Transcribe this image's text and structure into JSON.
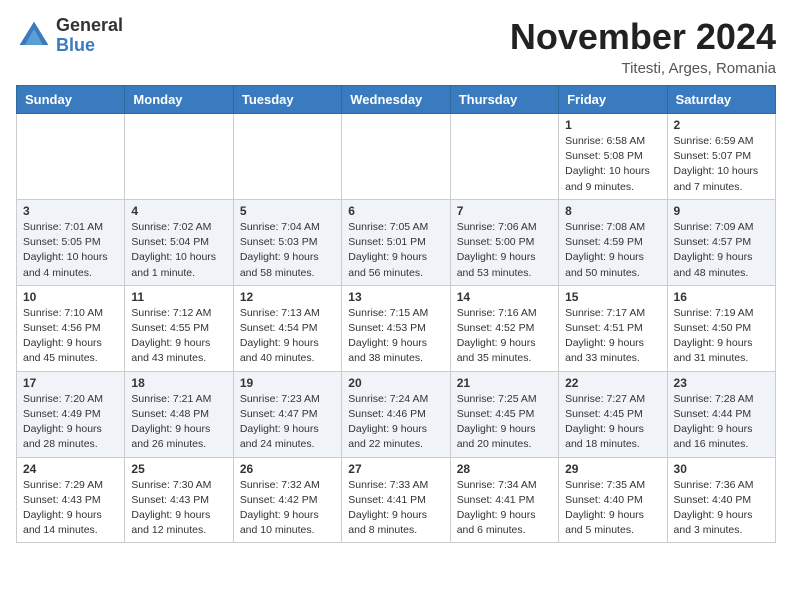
{
  "header": {
    "logo_line1": "General",
    "logo_line2": "Blue",
    "month_title": "November 2024",
    "location": "Titesti, Arges, Romania"
  },
  "weekdays": [
    "Sunday",
    "Monday",
    "Tuesday",
    "Wednesday",
    "Thursday",
    "Friday",
    "Saturday"
  ],
  "weeks": [
    [
      {
        "day": "",
        "info": ""
      },
      {
        "day": "",
        "info": ""
      },
      {
        "day": "",
        "info": ""
      },
      {
        "day": "",
        "info": ""
      },
      {
        "day": "",
        "info": ""
      },
      {
        "day": "1",
        "info": "Sunrise: 6:58 AM\nSunset: 5:08 PM\nDaylight: 10 hours and 9 minutes."
      },
      {
        "day": "2",
        "info": "Sunrise: 6:59 AM\nSunset: 5:07 PM\nDaylight: 10 hours and 7 minutes."
      }
    ],
    [
      {
        "day": "3",
        "info": "Sunrise: 7:01 AM\nSunset: 5:05 PM\nDaylight: 10 hours and 4 minutes."
      },
      {
        "day": "4",
        "info": "Sunrise: 7:02 AM\nSunset: 5:04 PM\nDaylight: 10 hours and 1 minute."
      },
      {
        "day": "5",
        "info": "Sunrise: 7:04 AM\nSunset: 5:03 PM\nDaylight: 9 hours and 58 minutes."
      },
      {
        "day": "6",
        "info": "Sunrise: 7:05 AM\nSunset: 5:01 PM\nDaylight: 9 hours and 56 minutes."
      },
      {
        "day": "7",
        "info": "Sunrise: 7:06 AM\nSunset: 5:00 PM\nDaylight: 9 hours and 53 minutes."
      },
      {
        "day": "8",
        "info": "Sunrise: 7:08 AM\nSunset: 4:59 PM\nDaylight: 9 hours and 50 minutes."
      },
      {
        "day": "9",
        "info": "Sunrise: 7:09 AM\nSunset: 4:57 PM\nDaylight: 9 hours and 48 minutes."
      }
    ],
    [
      {
        "day": "10",
        "info": "Sunrise: 7:10 AM\nSunset: 4:56 PM\nDaylight: 9 hours and 45 minutes."
      },
      {
        "day": "11",
        "info": "Sunrise: 7:12 AM\nSunset: 4:55 PM\nDaylight: 9 hours and 43 minutes."
      },
      {
        "day": "12",
        "info": "Sunrise: 7:13 AM\nSunset: 4:54 PM\nDaylight: 9 hours and 40 minutes."
      },
      {
        "day": "13",
        "info": "Sunrise: 7:15 AM\nSunset: 4:53 PM\nDaylight: 9 hours and 38 minutes."
      },
      {
        "day": "14",
        "info": "Sunrise: 7:16 AM\nSunset: 4:52 PM\nDaylight: 9 hours and 35 minutes."
      },
      {
        "day": "15",
        "info": "Sunrise: 7:17 AM\nSunset: 4:51 PM\nDaylight: 9 hours and 33 minutes."
      },
      {
        "day": "16",
        "info": "Sunrise: 7:19 AM\nSunset: 4:50 PM\nDaylight: 9 hours and 31 minutes."
      }
    ],
    [
      {
        "day": "17",
        "info": "Sunrise: 7:20 AM\nSunset: 4:49 PM\nDaylight: 9 hours and 28 minutes."
      },
      {
        "day": "18",
        "info": "Sunrise: 7:21 AM\nSunset: 4:48 PM\nDaylight: 9 hours and 26 minutes."
      },
      {
        "day": "19",
        "info": "Sunrise: 7:23 AM\nSunset: 4:47 PM\nDaylight: 9 hours and 24 minutes."
      },
      {
        "day": "20",
        "info": "Sunrise: 7:24 AM\nSunset: 4:46 PM\nDaylight: 9 hours and 22 minutes."
      },
      {
        "day": "21",
        "info": "Sunrise: 7:25 AM\nSunset: 4:45 PM\nDaylight: 9 hours and 20 minutes."
      },
      {
        "day": "22",
        "info": "Sunrise: 7:27 AM\nSunset: 4:45 PM\nDaylight: 9 hours and 18 minutes."
      },
      {
        "day": "23",
        "info": "Sunrise: 7:28 AM\nSunset: 4:44 PM\nDaylight: 9 hours and 16 minutes."
      }
    ],
    [
      {
        "day": "24",
        "info": "Sunrise: 7:29 AM\nSunset: 4:43 PM\nDaylight: 9 hours and 14 minutes."
      },
      {
        "day": "25",
        "info": "Sunrise: 7:30 AM\nSunset: 4:43 PM\nDaylight: 9 hours and 12 minutes."
      },
      {
        "day": "26",
        "info": "Sunrise: 7:32 AM\nSunset: 4:42 PM\nDaylight: 9 hours and 10 minutes."
      },
      {
        "day": "27",
        "info": "Sunrise: 7:33 AM\nSunset: 4:41 PM\nDaylight: 9 hours and 8 minutes."
      },
      {
        "day": "28",
        "info": "Sunrise: 7:34 AM\nSunset: 4:41 PM\nDaylight: 9 hours and 6 minutes."
      },
      {
        "day": "29",
        "info": "Sunrise: 7:35 AM\nSunset: 4:40 PM\nDaylight: 9 hours and 5 minutes."
      },
      {
        "day": "30",
        "info": "Sunrise: 7:36 AM\nSunset: 4:40 PM\nDaylight: 9 hours and 3 minutes."
      }
    ]
  ]
}
